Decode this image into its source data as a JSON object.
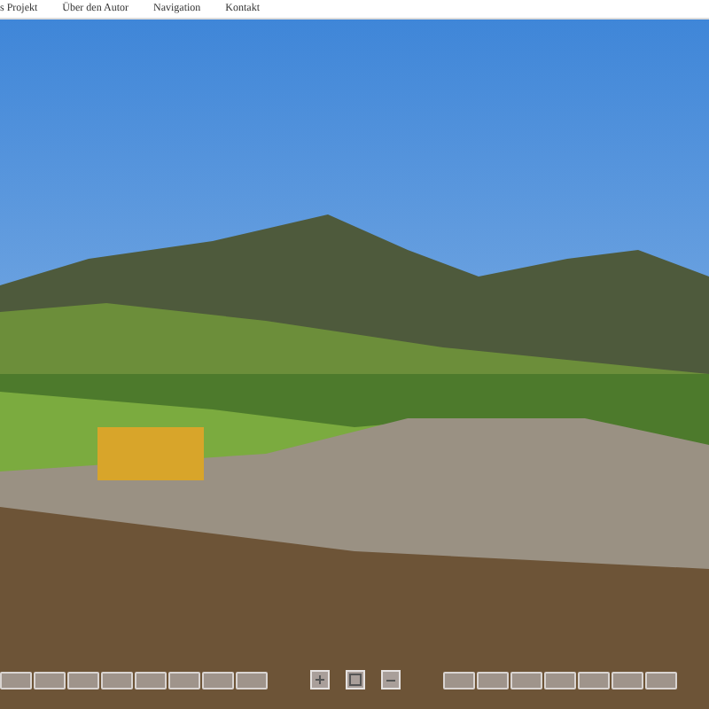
{
  "menu": [
    {
      "label": "s Projekt"
    },
    {
      "label": "Über den Autor"
    },
    {
      "label": "Navigation"
    },
    {
      "label": "Kontakt"
    }
  ],
  "toolbar": {
    "left": [
      {
        "kind": "blank"
      },
      {
        "kind": "blank"
      },
      {
        "kind": "blank"
      },
      {
        "kind": "blank"
      },
      {
        "kind": "blank"
      },
      {
        "kind": "blank"
      },
      {
        "kind": "blank"
      },
      {
        "kind": "blank"
      }
    ],
    "center": [
      {
        "kind": "plus"
      },
      {
        "kind": "fullscreen"
      },
      {
        "kind": "minus"
      }
    ],
    "right": [
      {
        "kind": "blank"
      },
      {
        "kind": "blank"
      },
      {
        "kind": "blank"
      },
      {
        "kind": "blank"
      },
      {
        "kind": "blank"
      },
      {
        "kind": "blank"
      },
      {
        "kind": "blank"
      }
    ]
  }
}
